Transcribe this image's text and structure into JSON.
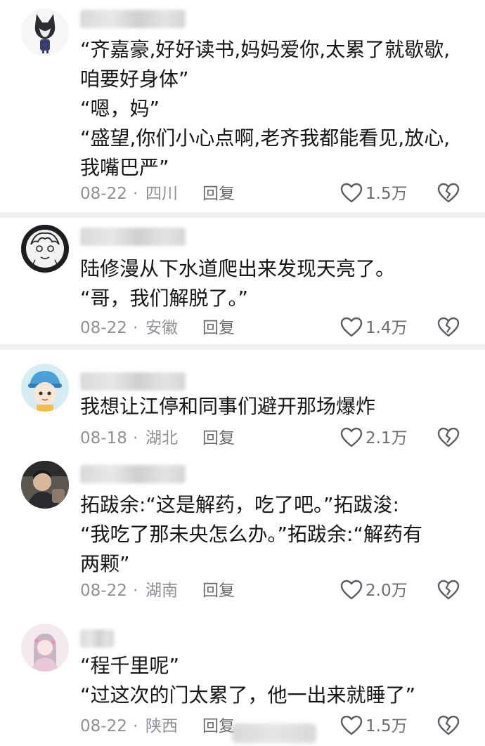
{
  "colors": {
    "text": "#161616",
    "meta": "#8f8f96",
    "separator": "#f1f1f3"
  },
  "comments": [
    {
      "avatar": "cat-avatar",
      "username": "",
      "lines": [
        "“齐嘉豪,好好读书,妈妈爱你,太累了就歇歇,",
        "咱要好身体”",
        "“嗯，妈”",
        "“盛望,你们小心点啊,老齐我都能看见,放心,",
        "我嘴巴严”"
      ],
      "date": "08-22",
      "location": "四川",
      "reply": "回复",
      "likes": "1.5万"
    },
    {
      "avatar": "anime-sketch-avatar",
      "username": "",
      "lines": [
        "陆修漫从下水道爬出来发现天亮了。",
        "“哥，我们解脱了。”"
      ],
      "date": "08-22",
      "location": "安徽",
      "reply": "回复",
      "likes": "1.4万"
    },
    {
      "avatar": "chibi-avatar",
      "username": "",
      "lines": [
        "我想让江停和同事们避开那场爆炸"
      ],
      "date": "08-18",
      "location": "湖北",
      "reply": "回复",
      "likes": "2.1万"
    },
    {
      "avatar": "photo-avatar",
      "username": "",
      "lines": [
        "拓跋余:“这是解药，吃了吧。”拓跋浚:",
        "“我吃了那未央怎么办。”拓跋余:“解药有",
        "两颗”"
      ],
      "date": "08-22",
      "location": "湖南",
      "reply": "回复",
      "likes": "2.0万"
    },
    {
      "avatar": "pink-girl-avatar",
      "username": "",
      "lines": [
        "“程千里呢”",
        "“过这次的门太累了，他一出来就睡了”"
      ],
      "date": "08-22",
      "location": "陕西",
      "reply": "回复",
      "likes": "1.5万"
    }
  ]
}
